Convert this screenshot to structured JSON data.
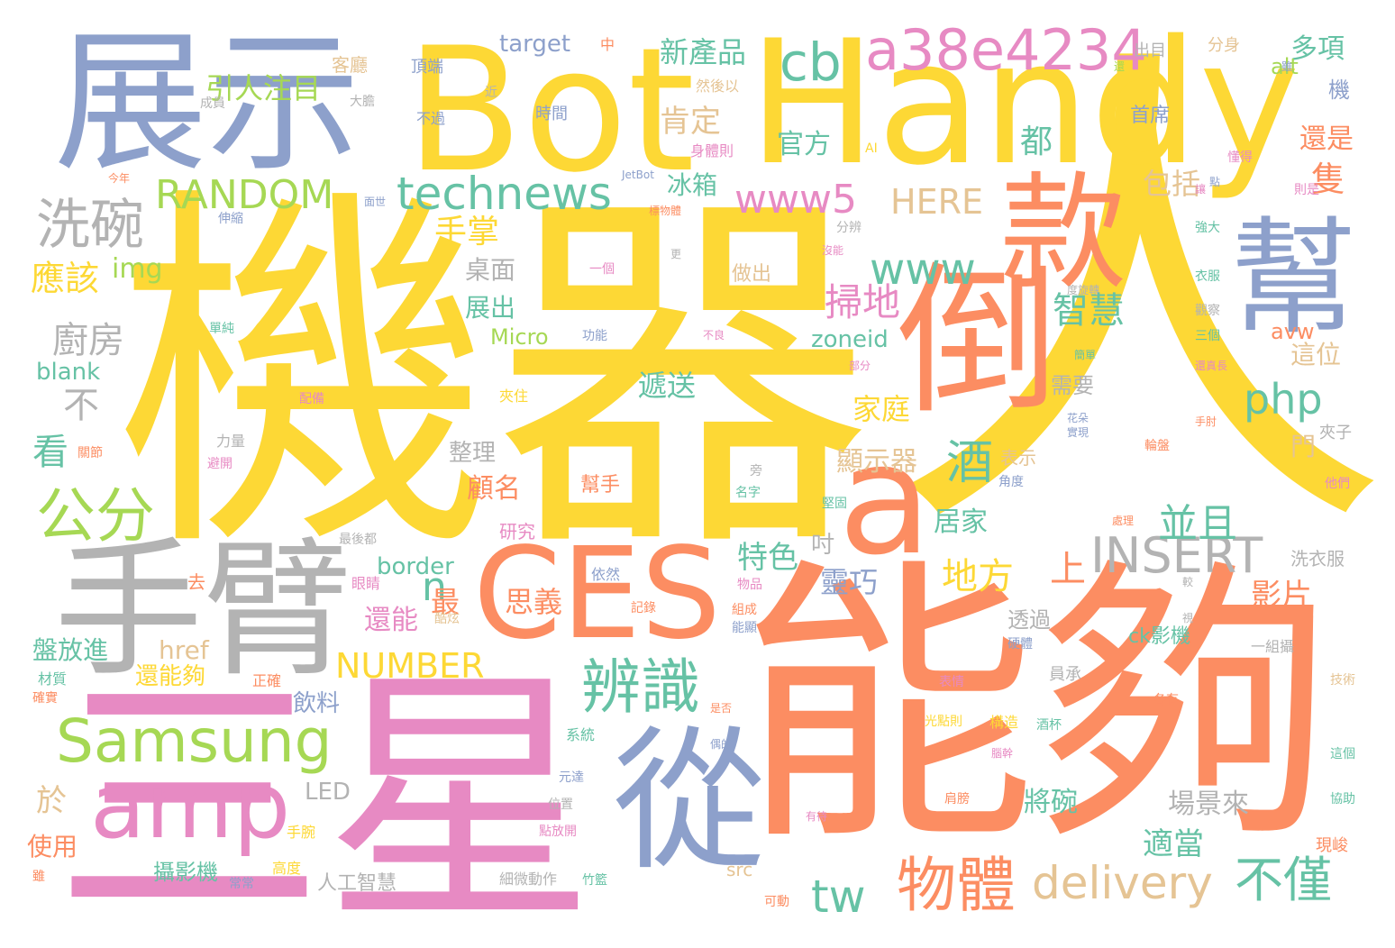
{
  "palette": {
    "yellow": "#fdd835",
    "blue": "#8da0cb",
    "orange": "#fc8d62",
    "pink": "#e78ac3",
    "green": "#66c2a5",
    "lime": "#a6d854",
    "tan": "#e5c494",
    "grey": "#b3b3b3"
  },
  "words": [
    {
      "text": "機器",
      "color": "#fdd835",
      "icon": "word"
    },
    {
      "text": "人",
      "color": "#fdd835"
    },
    {
      "text": "能夠",
      "color": "#fc8d62"
    },
    {
      "text": "三星",
      "color": "#e78ac3"
    },
    {
      "text": "Handy",
      "color": "#fdd835"
    },
    {
      "text": "Bot",
      "color": "#fdd835"
    },
    {
      "text": "展示",
      "color": "#8da0cb"
    },
    {
      "text": "手臂",
      "color": "#b3b3b3"
    },
    {
      "text": "倒",
      "color": "#fc8d62"
    },
    {
      "text": "款",
      "color": "#fc8d62"
    },
    {
      "text": "幫",
      "color": "#8da0cb"
    },
    {
      "text": "a",
      "color": "#fc8d62"
    },
    {
      "text": "CES",
      "color": "#fc8d62"
    },
    {
      "text": "從",
      "color": "#8da0cb"
    },
    {
      "text": "amp",
      "color": "#e78ac3"
    },
    {
      "text": "Samsung",
      "color": "#a6d854"
    },
    {
      "text": "a38e4234",
      "color": "#e78ac3"
    },
    {
      "text": "cb",
      "color": "#66c2a5"
    },
    {
      "text": "technews",
      "color": "#66c2a5"
    },
    {
      "text": "www5",
      "color": "#e78ac3"
    },
    {
      "text": "www",
      "color": "#66c2a5"
    },
    {
      "text": "RANDOM",
      "color": "#a6d854"
    },
    {
      "text": "HERE",
      "color": "#e5c494"
    },
    {
      "text": "洗碗",
      "color": "#b3b3b3"
    },
    {
      "text": "公分",
      "color": "#a6d854"
    },
    {
      "text": "辨識",
      "color": "#66c2a5"
    },
    {
      "text": "物體",
      "color": "#fc8d62"
    },
    {
      "text": "delivery",
      "color": "#e5c494"
    },
    {
      "text": "不僅",
      "color": "#66c2a5"
    },
    {
      "text": "tw",
      "color": "#66c2a5"
    },
    {
      "text": "INSERT",
      "color": "#b3b3b3"
    },
    {
      "text": "php",
      "color": "#66c2a5"
    },
    {
      "text": "酒",
      "color": "#66c2a5"
    },
    {
      "text": "n",
      "color": "#66c2a5"
    },
    {
      "text": "上",
      "color": "#fc8d62"
    },
    {
      "text": "並且",
      "color": "#66c2a5"
    },
    {
      "text": "地方",
      "color": "#fdd835"
    },
    {
      "text": "掃地",
      "color": "#e78ac3"
    },
    {
      "text": "智慧",
      "color": "#66c2a5"
    },
    {
      "text": "新產品",
      "color": "#66c2a5"
    },
    {
      "text": "引人注目",
      "color": "#a6d854"
    },
    {
      "text": "肯定",
      "color": "#e5c494"
    },
    {
      "text": "官方",
      "color": "#66c2a5"
    },
    {
      "text": "都",
      "color": "#66c2a5"
    },
    {
      "text": "多項",
      "color": "#66c2a5"
    },
    {
      "text": "還是",
      "color": "#fc8d62"
    },
    {
      "text": "隻",
      "color": "#fc8d62"
    },
    {
      "text": "包括",
      "color": "#e5c494"
    },
    {
      "text": "冰箱",
      "color": "#66c2a5"
    },
    {
      "text": "手掌",
      "color": "#fdd835"
    },
    {
      "text": "target",
      "color": "#8da0cb"
    },
    {
      "text": "應該",
      "color": "#fdd835"
    },
    {
      "text": "img",
      "color": "#a6d854"
    },
    {
      "text": "廚房",
      "color": "#b3b3b3"
    },
    {
      "text": "不",
      "color": "#b3b3b3"
    },
    {
      "text": "blank",
      "color": "#66c2a5"
    },
    {
      "text": "看",
      "color": "#66c2a5"
    },
    {
      "text": "桌面",
      "color": "#b3b3b3"
    },
    {
      "text": "展出",
      "color": "#66c2a5"
    },
    {
      "text": "Micro",
      "color": "#a6d854"
    },
    {
      "text": "zoneid",
      "color": "#66c2a5"
    },
    {
      "text": "遞送",
      "color": "#66c2a5"
    },
    {
      "text": "家庭",
      "color": "#fdd835"
    },
    {
      "text": "顯示器",
      "color": "#e5c494"
    },
    {
      "text": "整理",
      "color": "#b3b3b3"
    },
    {
      "text": "顧名",
      "color": "#fc8d62"
    },
    {
      "text": "特色",
      "color": "#66c2a5"
    },
    {
      "text": "吋",
      "color": "#b3b3b3"
    },
    {
      "text": "居家",
      "color": "#66c2a5"
    },
    {
      "text": "靈巧",
      "color": "#8da0cb"
    },
    {
      "text": "border",
      "color": "#66c2a5"
    },
    {
      "text": "思義",
      "color": "#fc8d62"
    },
    {
      "text": "最",
      "color": "#fc8d62"
    },
    {
      "text": "還能",
      "color": "#e78ac3"
    },
    {
      "text": "href",
      "color": "#e5c494"
    },
    {
      "text": "NUMBER",
      "color": "#fdd835"
    },
    {
      "text": "影片",
      "color": "#fc8d62"
    },
    {
      "text": "透過",
      "color": "#b3b3b3"
    },
    {
      "text": "盤放進",
      "color": "#66c2a5"
    },
    {
      "text": "還能夠",
      "color": "#fdd835"
    },
    {
      "text": "飲料",
      "color": "#8da0cb"
    },
    {
      "text": "於",
      "color": "#e5c494"
    },
    {
      "text": "使用",
      "color": "#fc8d62"
    },
    {
      "text": "攝影機",
      "color": "#66c2a5"
    },
    {
      "text": "LED",
      "color": "#b3b3b3"
    },
    {
      "text": "src",
      "color": "#e5c494"
    },
    {
      "text": "人工智慧",
      "color": "#b3b3b3"
    },
    {
      "text": "將碗",
      "color": "#66c2a5"
    },
    {
      "text": "場景來",
      "color": "#b3b3b3"
    },
    {
      "text": "適當",
      "color": "#66c2a5"
    },
    {
      "text": "ck影機",
      "color": "#66c2a5"
    },
    {
      "text": "需要",
      "color": "#b3b3b3"
    },
    {
      "text": "門",
      "color": "#e5c494"
    },
    {
      "text": "這位",
      "color": "#e5c494"
    },
    {
      "text": "avw",
      "color": "#fc8d62"
    },
    {
      "text": "alt",
      "color": "#a6d854"
    },
    {
      "text": "首席",
      "color": "#8da0cb"
    },
    {
      "text": "機",
      "color": "#8da0cb"
    },
    {
      "text": "做出",
      "color": "#e5c494"
    },
    {
      "text": "洗衣服",
      "color": "#b3b3b3"
    },
    {
      "text": "表示",
      "color": "#e5c494"
    },
    {
      "text": "幫手",
      "color": "#fc8d62"
    },
    {
      "text": "研究",
      "color": "#e78ac3"
    },
    {
      "text": "夾住",
      "color": "#fdd835"
    },
    {
      "text": "客廳",
      "color": "#e5c494"
    },
    {
      "text": "頂端",
      "color": "#8da0cb"
    },
    {
      "text": "然後以",
      "color": "#e5c494"
    },
    {
      "text": "時間",
      "color": "#8da0cb"
    },
    {
      "text": "身體則",
      "color": "#e78ac3"
    },
    {
      "text": "不過",
      "color": "#8da0cb"
    },
    {
      "text": "大膽",
      "color": "#b3b3b3"
    },
    {
      "text": "成員",
      "color": "#b3b3b3"
    },
    {
      "text": "出目",
      "color": "#b3b3b3"
    },
    {
      "text": "分身",
      "color": "#e5c494"
    },
    {
      "text": "中",
      "color": "#fc8d62"
    },
    {
      "text": "近",
      "color": "#b3b3b3"
    },
    {
      "text": "AI",
      "color": "#fdd835"
    },
    {
      "text": "JetBot",
      "color": "#8da0cb"
    },
    {
      "text": "今年",
      "color": "#fc8d62"
    },
    {
      "text": "伸縮",
      "color": "#8da0cb"
    },
    {
      "text": "面世",
      "color": "#8da0cb"
    },
    {
      "text": "標物體",
      "color": "#fc8d62"
    },
    {
      "text": "一個",
      "color": "#e78ac3"
    },
    {
      "text": "更",
      "color": "#b3b3b3"
    },
    {
      "text": "分辨",
      "color": "#b3b3b3"
    },
    {
      "text": "沒能",
      "color": "#e78ac3"
    },
    {
      "text": "功能",
      "color": "#8da0cb"
    },
    {
      "text": "不良",
      "color": "#e78ac3"
    },
    {
      "text": "單純",
      "color": "#66c2a5"
    },
    {
      "text": "部分",
      "color": "#e78ac3"
    },
    {
      "text": "配備",
      "color": "#e78ac3"
    },
    {
      "text": "力量",
      "color": "#b3b3b3"
    },
    {
      "text": "關節",
      "color": "#fc8d62"
    },
    {
      "text": "避開",
      "color": "#e78ac3"
    },
    {
      "text": "名字",
      "color": "#66c2a5"
    },
    {
      "text": "旁",
      "color": "#b3b3b3"
    },
    {
      "text": "堅固",
      "color": "#66c2a5"
    },
    {
      "text": "最後都",
      "color": "#b3b3b3"
    },
    {
      "text": "眼睛",
      "color": "#e78ac3"
    },
    {
      "text": "依然",
      "color": "#8da0cb"
    },
    {
      "text": "物品",
      "color": "#e78ac3"
    },
    {
      "text": "記錄",
      "color": "#fc8d62"
    },
    {
      "text": "組成",
      "color": "#fc8d62"
    },
    {
      "text": "能顯",
      "color": "#8da0cb"
    },
    {
      "text": "酷炫",
      "color": "#e5c494"
    },
    {
      "text": "去",
      "color": "#fc8d62"
    },
    {
      "text": "材質",
      "color": "#66c2a5"
    },
    {
      "text": "正確",
      "color": "#fc8d62"
    },
    {
      "text": "確實",
      "color": "#fc8d62"
    },
    {
      "text": "表情",
      "color": "#e78ac3"
    },
    {
      "text": "硬體",
      "color": "#8da0cb"
    },
    {
      "text": "員承",
      "color": "#b3b3b3"
    },
    {
      "text": "一組攝",
      "color": "#b3b3b3"
    },
    {
      "text": "技術",
      "color": "#e5c494"
    },
    {
      "text": "各有",
      "color": "#fc8d62"
    },
    {
      "text": "是否",
      "color": "#fc8d62"
    },
    {
      "text": "偶的",
      "color": "#8da0cb"
    },
    {
      "text": "光點則",
      "color": "#fdd835"
    },
    {
      "text": "構造",
      "color": "#fdd835"
    },
    {
      "text": "酒杯",
      "color": "#66c2a5"
    },
    {
      "text": "系統",
      "color": "#66c2a5"
    },
    {
      "text": "元達",
      "color": "#8da0cb"
    },
    {
      "text": "腦幹",
      "color": "#e78ac3"
    },
    {
      "text": "這個",
      "color": "#66c2a5"
    },
    {
      "text": "協助",
      "color": "#66c2a5"
    },
    {
      "text": "位置",
      "color": "#b3b3b3"
    },
    {
      "text": "肩膀",
      "color": "#fc8d62"
    },
    {
      "text": "有待",
      "color": "#e78ac3"
    },
    {
      "text": "手腕",
      "color": "#fdd835"
    },
    {
      "text": "點放開",
      "color": "#e78ac3"
    },
    {
      "text": "高度",
      "color": "#fdd835"
    },
    {
      "text": "常常",
      "color": "#8da0cb"
    },
    {
      "text": "細微動作",
      "color": "#b3b3b3"
    },
    {
      "text": "竹籃",
      "color": "#66c2a5"
    },
    {
      "text": "可動",
      "color": "#fc8d62"
    },
    {
      "text": "現峻",
      "color": "#fc8d62"
    },
    {
      "text": "雖",
      "color": "#fc8d62"
    },
    {
      "text": "夾子",
      "color": "#b3b3b3"
    },
    {
      "text": "他們",
      "color": "#e78ac3"
    },
    {
      "text": "角度",
      "color": "#8da0cb"
    },
    {
      "text": "處理",
      "color": "#fc8d62"
    },
    {
      "text": "輪盤",
      "color": "#fc8d62"
    },
    {
      "text": "實現",
      "color": "#8da0cb"
    },
    {
      "text": "花朵",
      "color": "#8da0cb"
    },
    {
      "text": "手肘",
      "color": "#fc8d62"
    },
    {
      "text": "簡單",
      "color": "#66c2a5"
    },
    {
      "text": "還真長",
      "color": "#e78ac3"
    },
    {
      "text": "三個",
      "color": "#66c2a5"
    },
    {
      "text": "觀察",
      "color": "#b3b3b3"
    },
    {
      "text": "衣服",
      "color": "#66c2a5"
    },
    {
      "text": "強大",
      "color": "#66c2a5"
    },
    {
      "text": "度旋轉",
      "color": "#b3b3b3"
    },
    {
      "text": "則是",
      "color": "#e78ac3"
    },
    {
      "text": "懂得",
      "color": "#e78ac3"
    },
    {
      "text": "雖",
      "color": "#8da0cb"
    },
    {
      "text": "讓",
      "color": "#e78ac3"
    },
    {
      "text": "還",
      "color": "#a6d854"
    },
    {
      "text": "點",
      "color": "#8da0cb"
    },
    {
      "text": "較",
      "color": "#b3b3b3"
    },
    {
      "text": "視",
      "color": "#b3b3b3"
    }
  ]
}
